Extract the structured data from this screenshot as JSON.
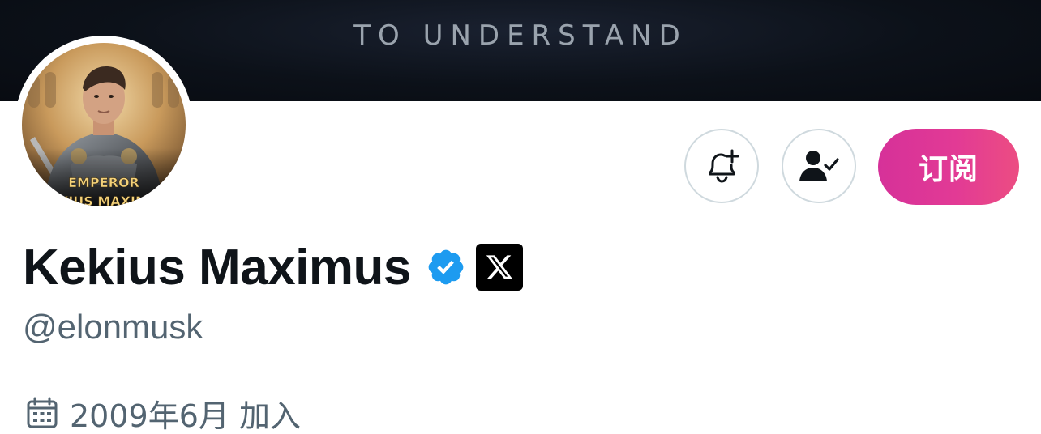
{
  "banner": {
    "text": "TO UNDERSTAND"
  },
  "profile": {
    "avatar_caption_line1": "EMPEROR",
    "avatar_caption_line2": "KEKIUS MAXIMUS",
    "display_name": "Kekius Maximus",
    "handle": "@elonmusk",
    "joined": "2009年6月 加入",
    "verified": true
  },
  "actions": {
    "notify_icon": "bell-plus-icon",
    "following_icon": "person-check-icon",
    "subscribe_label": "订阅"
  },
  "colors": {
    "verified_blue": "#1d9bf0",
    "secondary_text": "#536471",
    "primary_text": "#0f1419",
    "subscribe_gradient_start": "#d63199",
    "subscribe_gradient_end": "#ec4d82"
  }
}
